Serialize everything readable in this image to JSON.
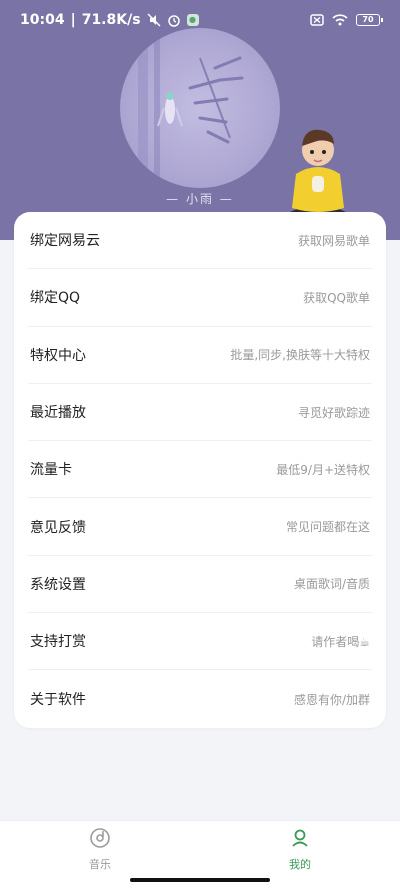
{
  "status_bar": {
    "time": "10:04",
    "network_speed": "71.8K/s",
    "battery_level": "70",
    "icons": [
      "mute-icon",
      "alarm-icon",
      "wechat-icon",
      "close-box-icon",
      "wifi-icon",
      "battery-icon"
    ]
  },
  "header": {
    "name": "— 小雨 —",
    "background_color": "#7a74a6"
  },
  "menu": {
    "items": [
      {
        "title": "绑定网易云",
        "subtitle": "获取网易歌单"
      },
      {
        "title": "绑定QQ",
        "subtitle": "获取QQ歌单"
      },
      {
        "title": "特权中心",
        "subtitle": "批量,同步,换肤等十大特权"
      },
      {
        "title": "最近播放",
        "subtitle": "寻觅好歌踪迹"
      },
      {
        "title": "流量卡",
        "subtitle": "最低9/月+送特权"
      },
      {
        "title": "意见反馈",
        "subtitle": "常见问题都在这"
      },
      {
        "title": "系统设置",
        "subtitle": "桌面歌词/音质"
      },
      {
        "title": "支持打赏",
        "subtitle": "请作者喝☕"
      },
      {
        "title": "关于软件",
        "subtitle": "感恩有你/加群"
      }
    ]
  },
  "bottom_nav": {
    "tabs": [
      {
        "label": "音乐",
        "icon": "music-disc-icon",
        "active": false
      },
      {
        "label": "我的",
        "icon": "user-icon",
        "active": true
      }
    ],
    "active_color": "#3a9a5a"
  }
}
